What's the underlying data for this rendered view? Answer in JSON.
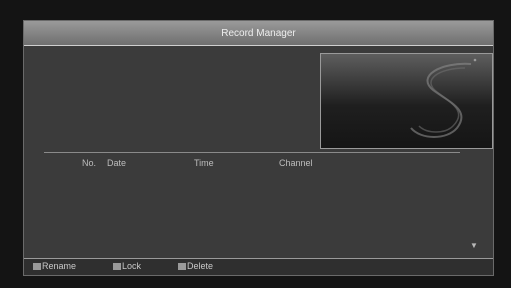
{
  "window": {
    "title": "Record Manager"
  },
  "list": {
    "columns": {
      "no": "No.",
      "date": "Date",
      "time": "Time",
      "channel": "Channel"
    },
    "rows": []
  },
  "preview": {
    "logo_icon": "s-logo-watermark"
  },
  "scroll": {
    "icon": "scroll-down-arrow"
  },
  "footer": {
    "rename": "Rename",
    "lock": "Lock",
    "delete": "Delete"
  },
  "colors": {
    "panel": "#3b3b3b",
    "title_bar": "#8a8a8a",
    "background": "#141414"
  }
}
